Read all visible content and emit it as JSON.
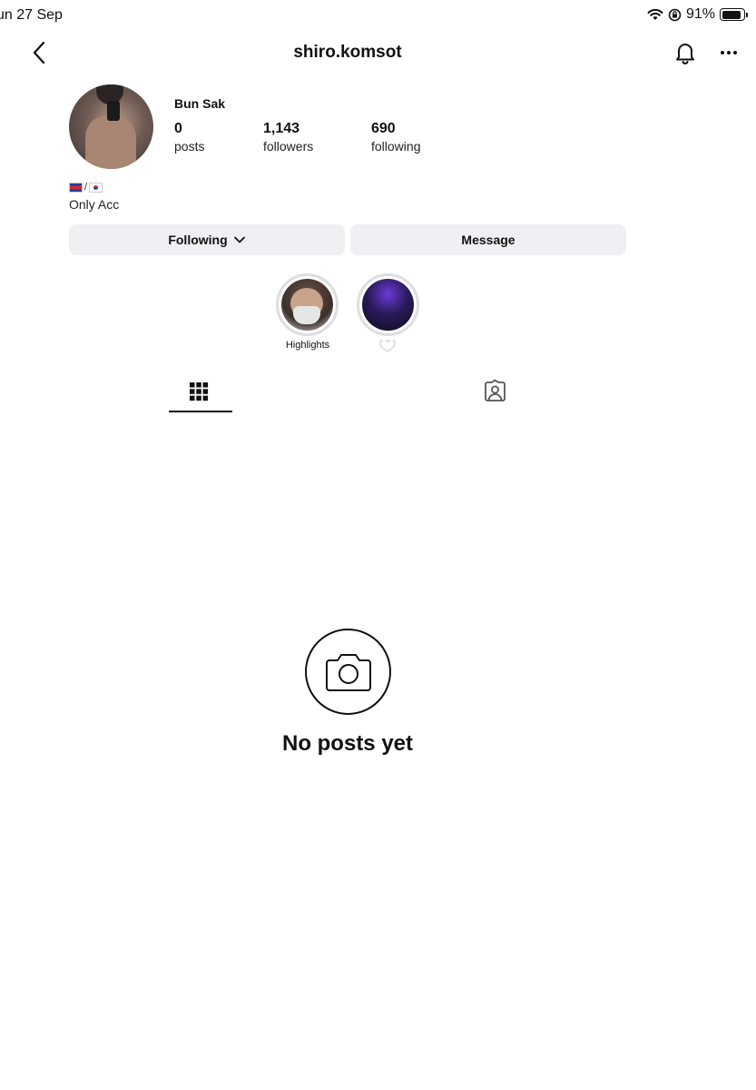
{
  "status_bar": {
    "date": "un 27 Sep",
    "battery": "91%",
    "battery_level": 0.91
  },
  "nav": {
    "username": "shiro.komsot",
    "back_icon": "chevron-left-icon",
    "bell_icon": "bell-icon",
    "more_icon": "ellipsis-icon"
  },
  "profile": {
    "display_name": "Bun Sak",
    "stats": {
      "posts": {
        "value": "0",
        "label": "posts"
      },
      "followers": {
        "value": "1,143",
        "label": "followers"
      },
      "following": {
        "value": "690",
        "label": "following"
      }
    },
    "bio_separator": "/",
    "bio": "Only Acc"
  },
  "actions": {
    "following_label": "Following",
    "message_label": "Message"
  },
  "highlights": [
    {
      "label": "Highlights"
    },
    {
      "label": ""
    }
  ],
  "tabs": [
    {
      "name": "posts-grid",
      "icon": "grid-icon",
      "active": true
    },
    {
      "name": "tagged",
      "icon": "tagged-person-icon",
      "active": false
    }
  ],
  "empty_state": {
    "icon": "camera-icon",
    "text": "No posts yet"
  },
  "colors": {
    "button_bg": "#eff0f3",
    "text": "#111111",
    "ring": "#dddee1"
  }
}
